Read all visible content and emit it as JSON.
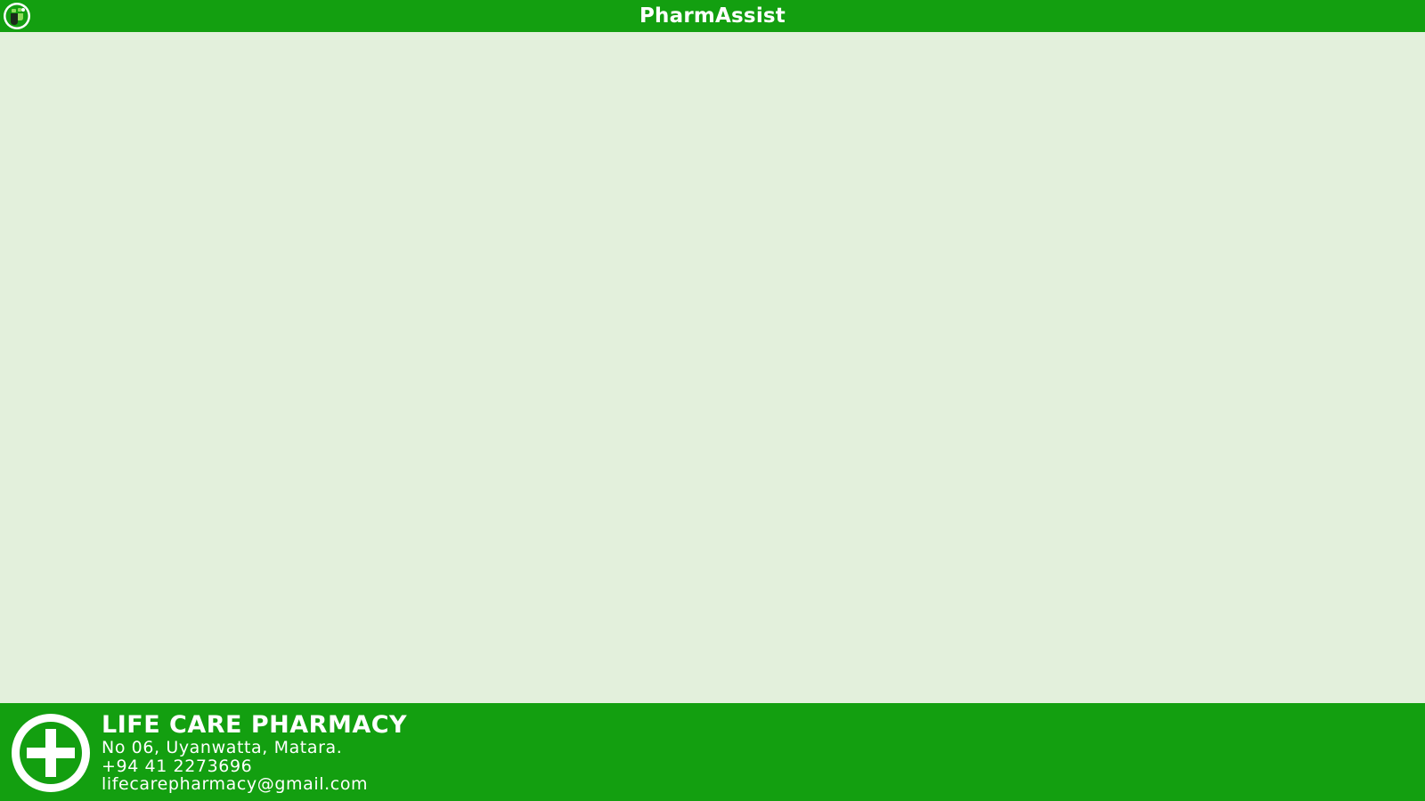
{
  "titlebar": {
    "app_title": "PharmAssist",
    "app_icon": "pharmacy-logo-icon"
  },
  "footer": {
    "logo_icon": "medical-cross-icon",
    "pharmacy_name": "LIFE CARE PHARMACY",
    "address": "No 06, Uyanwatta, Matara.",
    "phone": "+94 41 2273696",
    "email": "lifecarepharmacy@gmail.com"
  },
  "colors": {
    "brand_green": "#139f10",
    "background": "#e3f0dc",
    "text_on_brand": "#ffffff"
  }
}
